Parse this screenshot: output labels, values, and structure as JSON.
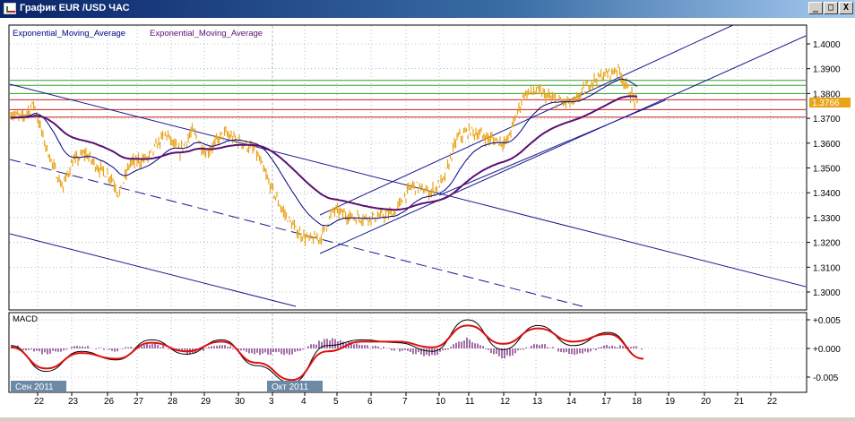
{
  "window": {
    "title": "График EUR /USD  ЧАС",
    "btn_minimize": "_",
    "btn_restore": "□",
    "btn_close": "X"
  },
  "indicators": {
    "ema_label_1": "Exponential_Moving_Average",
    "ema_label_2": "Exponential_Moving_Average",
    "macd_label": "MACD"
  },
  "colors": {
    "background": "#ffffff",
    "grid": "#8090a8",
    "price": "#e8a317",
    "ema_fast": "#000080",
    "ema_slow": "#5a1070",
    "channel": "#1a1a90",
    "hline_red": "#cc2020",
    "hline_green": "#30a030",
    "macd_line": "#000000",
    "macd_signal": "#dd1010",
    "macd_hist": "#6a1070",
    "price_tag": "#e8a317"
  },
  "price_axis": {
    "ticks": [
      "1.4000",
      "1.3900",
      "1.3800",
      "1.3700",
      "1.3600",
      "1.3500",
      "1.3400",
      "1.3300",
      "1.3200",
      "1.3100",
      "1.3000"
    ],
    "current_price": "1.3766"
  },
  "macd_axis": {
    "ticks": [
      "+0.005",
      "+0.000",
      "-0.005"
    ]
  },
  "time_axis": {
    "labels": [
      "22",
      "23",
      "26",
      "27",
      "28",
      "29",
      "30",
      "3",
      "4",
      "5",
      "6",
      "7",
      "10",
      "11",
      "12",
      "13",
      "14",
      "17",
      "18",
      "19",
      "20",
      "21",
      "22"
    ],
    "month_markers": [
      "Сен 2011",
      "Окт 2011"
    ]
  },
  "horizontal_levels": [
    {
      "price": 1.3853,
      "color": "green"
    },
    {
      "price": 1.3833,
      "color": "green"
    },
    {
      "price": 1.38,
      "color": "green"
    },
    {
      "price": 1.3775,
      "color": "red"
    },
    {
      "price": 1.3735,
      "color": "red"
    },
    {
      "price": 1.3705,
      "color": "red"
    }
  ],
  "chart_data": [
    {
      "type": "line",
      "title": "График EUR /USD  ЧАС",
      "x": [
        "22",
        "23",
        "26",
        "27",
        "28",
        "29",
        "30",
        "3",
        "4",
        "5",
        "6",
        "7",
        "10",
        "11",
        "12",
        "13",
        "14",
        "17",
        "18"
      ],
      "y_range": [
        1.295,
        1.41
      ],
      "series": [
        {
          "values": [
            1.372,
            1.354,
            1.352,
            1.343,
            1.355,
            1.364,
            1.357,
            1.357,
            1.322,
            1.332,
            1.33,
            1.335,
            1.346,
            1.365,
            1.362,
            1.379,
            1.376,
            1.385,
            1.374
          ]
        }
      ]
    },
    {
      "type": "line",
      "title": "MACD",
      "x": [
        "22",
        "23",
        "26",
        "27",
        "28",
        "29",
        "30",
        "3",
        "4",
        "5",
        "6",
        "7",
        "10",
        "11",
        "12",
        "13",
        "14",
        "17",
        "18"
      ],
      "y_range": [
        -0.007,
        0.007
      ],
      "series": [
        {
          "values": [
            0.0005,
            -0.004,
            -0.0005,
            -0.002,
            0.0015,
            -0.001,
            0.0015,
            -0.003,
            -0.006,
            0.0005,
            0.0015,
            0.001,
            -0.0005,
            0.005,
            -0.0002,
            0.004,
            0.0005,
            0.0028,
            -0.0018
          ]
        },
        {
          "values": [
            0.0002,
            -0.0035,
            -0.0008,
            -0.0018,
            0.001,
            -0.0005,
            0.0012,
            -0.0025,
            -0.0055,
            -0.0005,
            0.0012,
            0.0012,
            0.0002,
            0.004,
            0.0008,
            0.0035,
            0.0012,
            0.0025,
            -0.0018
          ]
        }
      ]
    }
  ]
}
